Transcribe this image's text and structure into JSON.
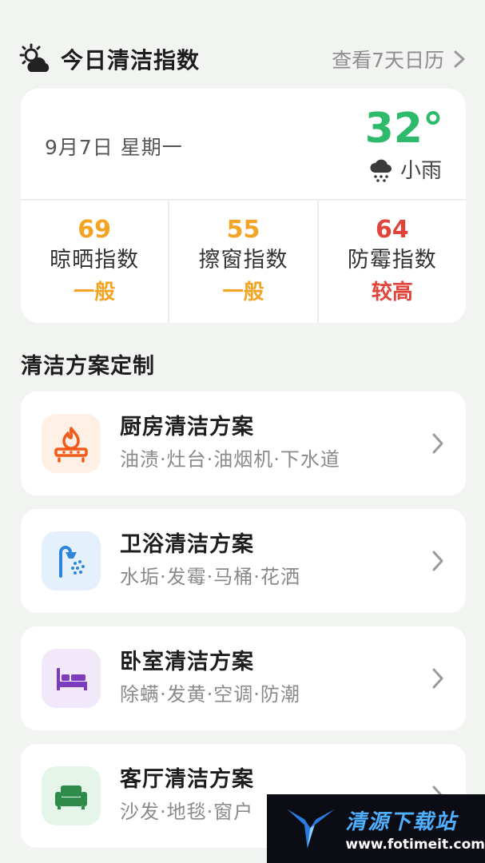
{
  "header": {
    "title": "今日清洁指数",
    "link": "查看7天日历"
  },
  "weather": {
    "date": "9月7日  星期一",
    "temperature": "32°",
    "condition": "小雨"
  },
  "indices": [
    {
      "value": "69",
      "name": "晾晒指数",
      "level": "一般",
      "color": "#f3a423"
    },
    {
      "value": "55",
      "name": "擦窗指数",
      "level": "一般",
      "color": "#f3a423"
    },
    {
      "value": "64",
      "name": "防霉指数",
      "level": "较高",
      "color": "#e0443a"
    }
  ],
  "section": {
    "title": "清洁方案定制"
  },
  "plans": [
    {
      "title": "厨房清洁方案",
      "subtitle": "油渍·灶台·油烟机·下水道",
      "icon": "stove-icon",
      "bg": "#fff0e6",
      "fg": "#f05a1a"
    },
    {
      "title": "卫浴清洁方案",
      "subtitle": "水垢·发霉·马桶·花洒",
      "icon": "shower-icon",
      "bg": "#e4f1fd",
      "fg": "#2f86d6"
    },
    {
      "title": "卧室清洁方案",
      "subtitle": "除螨·发黄·空调·防潮",
      "icon": "bed-icon",
      "bg": "#f1e8fa",
      "fg": "#7d3bbd"
    },
    {
      "title": "客厅清洁方案",
      "subtitle": "沙发·地毯·窗户",
      "icon": "sofa-icon",
      "bg": "#e6f5ea",
      "fg": "#2e8b4a"
    }
  ],
  "watermark": {
    "name": "清源下载站",
    "url": "www.fotimeit.com"
  }
}
